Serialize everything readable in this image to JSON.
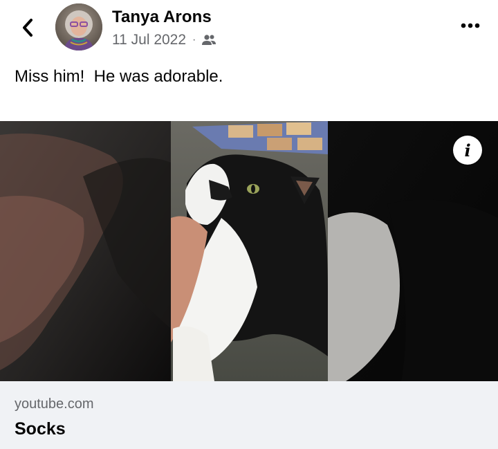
{
  "header": {
    "author": "Tanya Arons",
    "date": "11 Jul 2022",
    "separator": "·",
    "audience_icon": "friends-icon",
    "back_icon": "chevron-left-icon",
    "more_icon": "more-options-icon"
  },
  "post": {
    "text": "Miss him!  He was adorable."
  },
  "media": {
    "info_label": "i",
    "info_icon": "info-icon"
  },
  "link_card": {
    "domain": "youtube.com",
    "title": "Socks"
  },
  "colors": {
    "text_primary": "#050505",
    "text_secondary": "#65676b",
    "card_background": "#f0f2f5",
    "media_background": "#000000"
  }
}
